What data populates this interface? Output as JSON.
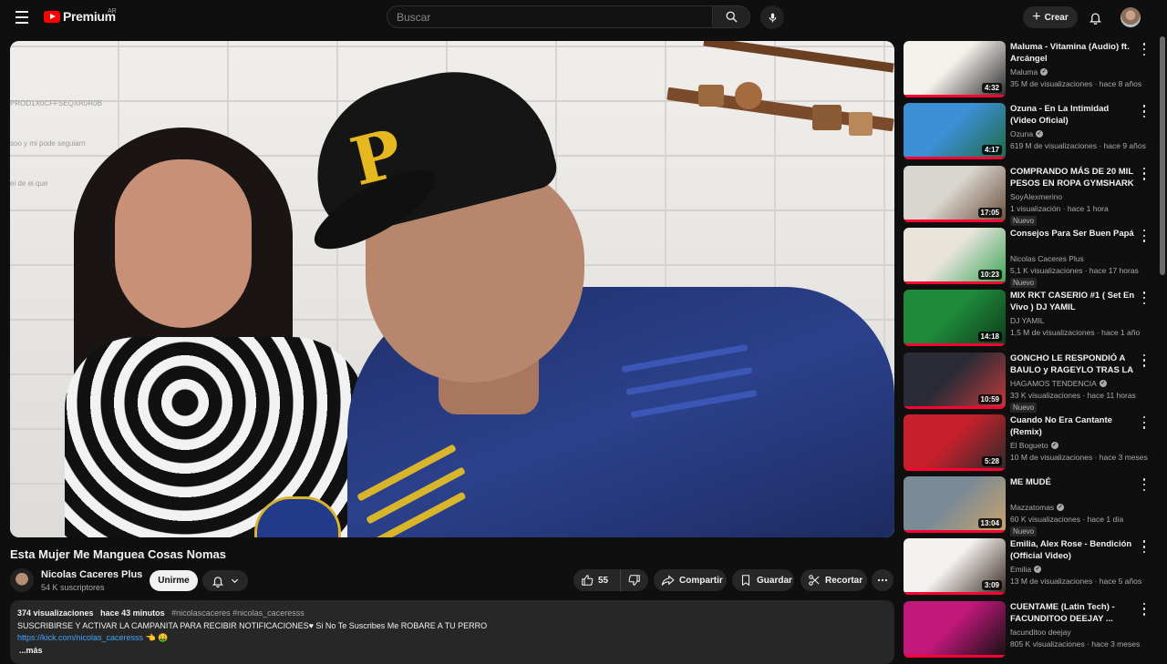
{
  "header": {
    "logo_text": "Premium",
    "country_code": "AR",
    "search_placeholder": "Buscar",
    "create_label": "Crear"
  },
  "player": {
    "overlay_lines": [
      "PROD1X0CFFSEQXR0R0B",
      "soo y mi pode seguiarn",
      "ei de ei que"
    ]
  },
  "video": {
    "title": "Esta Mujer Me Manguea Cosas Nomas",
    "channel_name": "Nicolas Caceres Plus",
    "subscribers": "54 K suscriptores",
    "join_label": "Unirme",
    "likes": "55",
    "share_label": "Compartir",
    "save_label": "Guardar",
    "clip_label": "Recortar",
    "description": {
      "views": "374 visualizaciones",
      "posted": "hace 43 minutos",
      "hashtags": "#nicolascaceres #nicolas_caceresss",
      "text": "SUSCRIBIRSE Y ACTIVAR LA CAMPANITA PARA RECIBIR NOTIFICACIONES♥  Si No Te Suscribes Me ROBARE A TU PERRO",
      "link": "https://kick.com/nicolas_caceresss",
      "link_suffix": "👈 🤑",
      "more": "...más"
    }
  },
  "recommendations": [
    {
      "title": "Maluma - Vitamina (Audio) ft. Arcángel",
      "channel": "Maluma",
      "verified": true,
      "meta": "35 M de visualizaciones · hace 8 años",
      "duration": "4:32",
      "new": "",
      "thumb_colors": [
        "#f4f1ec",
        "#2a2a2a"
      ]
    },
    {
      "title": "Ozuna - En La Intimidad (Video Oficial)",
      "channel": "Ozuna",
      "verified": true,
      "meta": "619 M de visualizaciones · hace 9 años",
      "duration": "4:17",
      "new": "",
      "thumb_colors": [
        "#3d8fd6",
        "#1e6b45"
      ]
    },
    {
      "title": "COMPRANDO MÁS DE 20 MIL PESOS EN ROPA GYMSHARK",
      "channel": "SoyAlexmerino",
      "verified": false,
      "meta": "1 visualización · hace 1 hora",
      "duration": "17:05",
      "new": "Nuevo",
      "thumb_colors": [
        "#d9d6cf",
        "#6a4e3a"
      ]
    },
    {
      "title": "Consejos Para Ser Buen Papá",
      "channel": "Nicolas Caceres Plus",
      "verified": false,
      "meta": "5,1 K visualizaciones · hace 17 horas",
      "duration": "10:23",
      "new": "Nuevo",
      "thumb_colors": [
        "#e8e4dc",
        "#3aa655"
      ]
    },
    {
      "title": "MIX RKT CASERIO #1 ( Set En Vivo ) DJ YAMIL",
      "channel": "DJ YAMIL",
      "verified": false,
      "meta": "1,5 M de visualizaciones · hace 1 año",
      "duration": "14:18",
      "new": "",
      "thumb_colors": [
        "#1f8a3a",
        "#0c3d1b"
      ]
    },
    {
      "title": "GONCHO LE RESPONDIÓ A BAULO y RAGEYLO TRAS LA ...",
      "channel": "HAGAMOS TENDENCIA",
      "verified": true,
      "meta": "33 K visualizaciones · hace 11 horas",
      "duration": "10:59",
      "new": "Nuevo",
      "thumb_colors": [
        "#2b2b36",
        "#c23a3a"
      ]
    },
    {
      "title": "Cuando No Era Cantante (Remix)",
      "channel": "El Bogueto",
      "verified": true,
      "meta": "10 M de visualizaciones · hace 3 meses",
      "duration": "5:28",
      "new": "",
      "thumb_colors": [
        "#c8202a",
        "#2a2a2a"
      ]
    },
    {
      "title": "ME MUDÉ",
      "channel": "Mazzatomas",
      "verified": true,
      "meta": "60 K visualizaciones · hace 1 día",
      "duration": "13:04",
      "new": "Nuevo",
      "thumb_colors": [
        "#7a8a96",
        "#c9a46a"
      ]
    },
    {
      "title": "Emilia, Alex Rose - Bendición (Official Video)",
      "channel": "Emilia",
      "verified": true,
      "meta": "13 M de visualizaciones · hace 5 años",
      "duration": "3:09",
      "new": "",
      "thumb_colors": [
        "#f4f2f0",
        "#3a2a22"
      ]
    },
    {
      "title": "CUENTAME (Latin Tech) - FACUNDITOO DEEJAY ...",
      "channel": "facunditoo deejay",
      "verified": false,
      "meta": "805 K visualizaciones · hace 3 meses",
      "duration": "",
      "new": "",
      "thumb_colors": [
        "#c2187a",
        "#111111"
      ]
    }
  ],
  "colors": {
    "background": "#0f0f0f",
    "accent_red": "#ff0000",
    "link_blue": "#3ea6ff",
    "progress_red": "#ff0033"
  }
}
